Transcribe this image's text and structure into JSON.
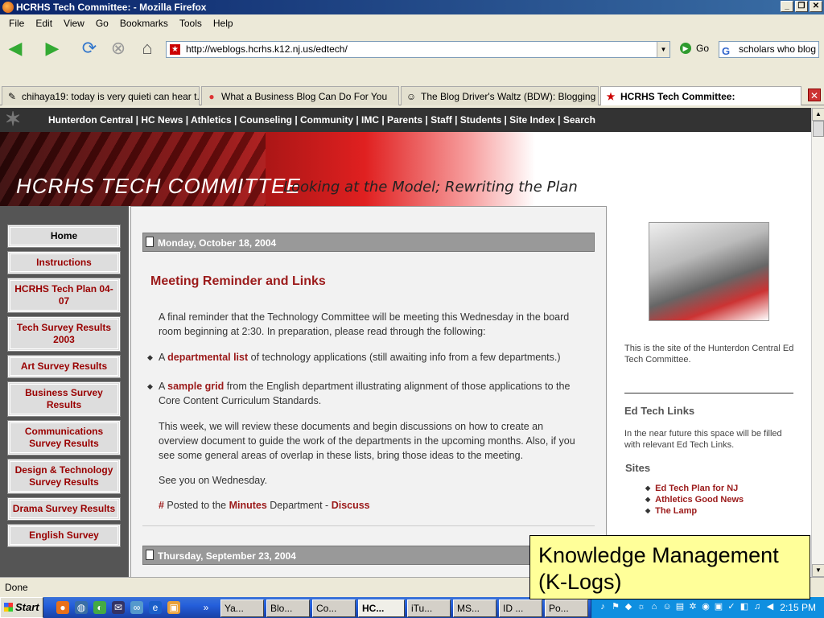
{
  "window": {
    "title": "HCRHS Tech Committee: - Mozilla Firefox"
  },
  "menu": [
    "File",
    "Edit",
    "View",
    "Go",
    "Bookmarks",
    "Tools",
    "Help"
  ],
  "address": {
    "url": "http://weblogs.hcrhs.k12.nj.us/edtech/",
    "go_label": "Go"
  },
  "search": {
    "value": "scholars who blog"
  },
  "tabs": [
    {
      "label": "chihaya19: today is very quieti can hear t...",
      "icon": "pencil-icon"
    },
    {
      "label": "What a Business Blog Can Do For You",
      "icon": "red-ball-icon"
    },
    {
      "label": "The Blog Driver's Waltz (BDW): Blogging Pr...",
      "icon": "face-icon"
    },
    {
      "label": "HCRHS Tech Committee:",
      "icon": "star-icon"
    }
  ],
  "site": {
    "nav": "Hunterdon Central | HC News | Athletics | Counseling | Community | IMC | Parents | Staff | Students | Site Index | Search",
    "banner_title": "HCRHS TECH COMMITTEE",
    "banner_subtitle": "Looking at the Model; Rewriting the Plan"
  },
  "leftnav": [
    "Home",
    "Instructions",
    "HCRHS Tech Plan 04-07",
    "Tech Survey Results 2003",
    "Art Survey Results",
    "Business Survey Results",
    "Communications Survey Results",
    "Design & Technology Survey Results",
    "Drama Survey Results",
    "English Survey"
  ],
  "post": {
    "date": "Monday, October 18, 2004",
    "title": "Meeting Reminder and Links",
    "intro": "A final reminder that the Technology Committee will be meeting this Wednesday in the board room beginning at 2:30. In preparation, please read through the following:",
    "b1_pre": "A ",
    "b1_link": "departmental list",
    "b1_post": " of technology applications (still awaiting info from a few departments.)",
    "b2_pre": "A ",
    "b2_link": "sample grid",
    "b2_post": " from the English department illustrating alignment of those applications to the Core Content Curriculum Standards.",
    "para2": " This week, we will review these documents and begin discussions on how to create an overview document to guide the work of the departments in the upcoming months. Also, if you see some general areas of overlap in these lists, bring those ideas to the meeting.",
    "para3": "See you on Wednesday.",
    "footer_hash": "#",
    "footer_text": " Posted to the ",
    "footer_dept": "Minutes",
    "footer_text2": " Department - ",
    "footer_discuss": "Discuss"
  },
  "post2": {
    "date": "Thursday, September 23, 2004"
  },
  "sidebar": {
    "about": "This is the site of the Hunterdon Central Ed Tech Committee.",
    "links_heading": "Ed Tech Links",
    "links_text": "In the near future this space will be filled with relevant Ed Tech Links.",
    "sites_heading": "Sites",
    "sites": [
      "Ed Tech Plan for NJ",
      "Athletics Good News",
      "The Lamp"
    ]
  },
  "overlay": {
    "line1": "Knowledge Management",
    "line2": "(K-Logs)"
  },
  "status": {
    "text": "Done"
  },
  "taskbar": {
    "start": "Start",
    "items": [
      "Ya...",
      "Blo...",
      "Co...",
      "HC...",
      "iTu...",
      "MS...",
      "ID ...",
      "Po..."
    ],
    "clock": "2:15 PM"
  }
}
